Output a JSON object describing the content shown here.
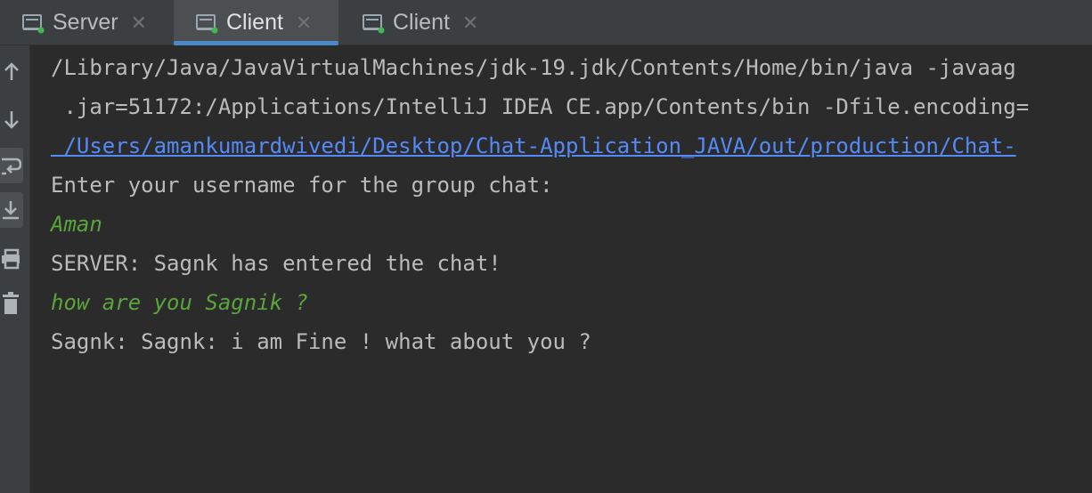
{
  "tabs": [
    {
      "label": "Server",
      "icon": "console-run-icon",
      "active": false
    },
    {
      "label": "Client",
      "icon": "console-run-icon",
      "active": true
    },
    {
      "label": "Client",
      "icon": "console-run-icon",
      "active": false
    }
  ],
  "toolbar": {
    "icons": [
      "arrow-up-icon",
      "arrow-down-icon",
      "soft-wrap-icon",
      "scroll-to-end-icon",
      "print-icon",
      "trash-icon"
    ]
  },
  "console": {
    "lines": [
      {
        "text": "/Library/Java/JavaVirtualMachines/jdk-19.jdk/Contents/Home/bin/java -javaag",
        "kind": "output"
      },
      {
        "text": " .jar=51172:/Applications/IntelliJ IDEA CE.app/Contents/bin -Dfile.encoding=",
        "kind": "output"
      },
      {
        "text": " /Users/amankumardwivedi/Desktop/Chat-Application_JAVA/out/production/Chat-",
        "kind": "link"
      },
      {
        "text": "Enter your username for the group chat:",
        "kind": "output"
      },
      {
        "text": "Aman",
        "kind": "input"
      },
      {
        "text": "SERVER: Sagnk has entered the chat!",
        "kind": "output"
      },
      {
        "text": "how are you Sagnik ?",
        "kind": "input"
      },
      {
        "text": "Sagnk: Sagnk: i am Fine ! what about you ?",
        "kind": "output"
      }
    ]
  },
  "colors": {
    "background": "#2b2b2b",
    "toolbar": "#3c3f41",
    "output_text": "#bbbbbb",
    "user_input": "#5aa43c",
    "link": "#548af7",
    "active_tab_underline": "#4a88c7",
    "run_indicator": "#3fb950"
  }
}
